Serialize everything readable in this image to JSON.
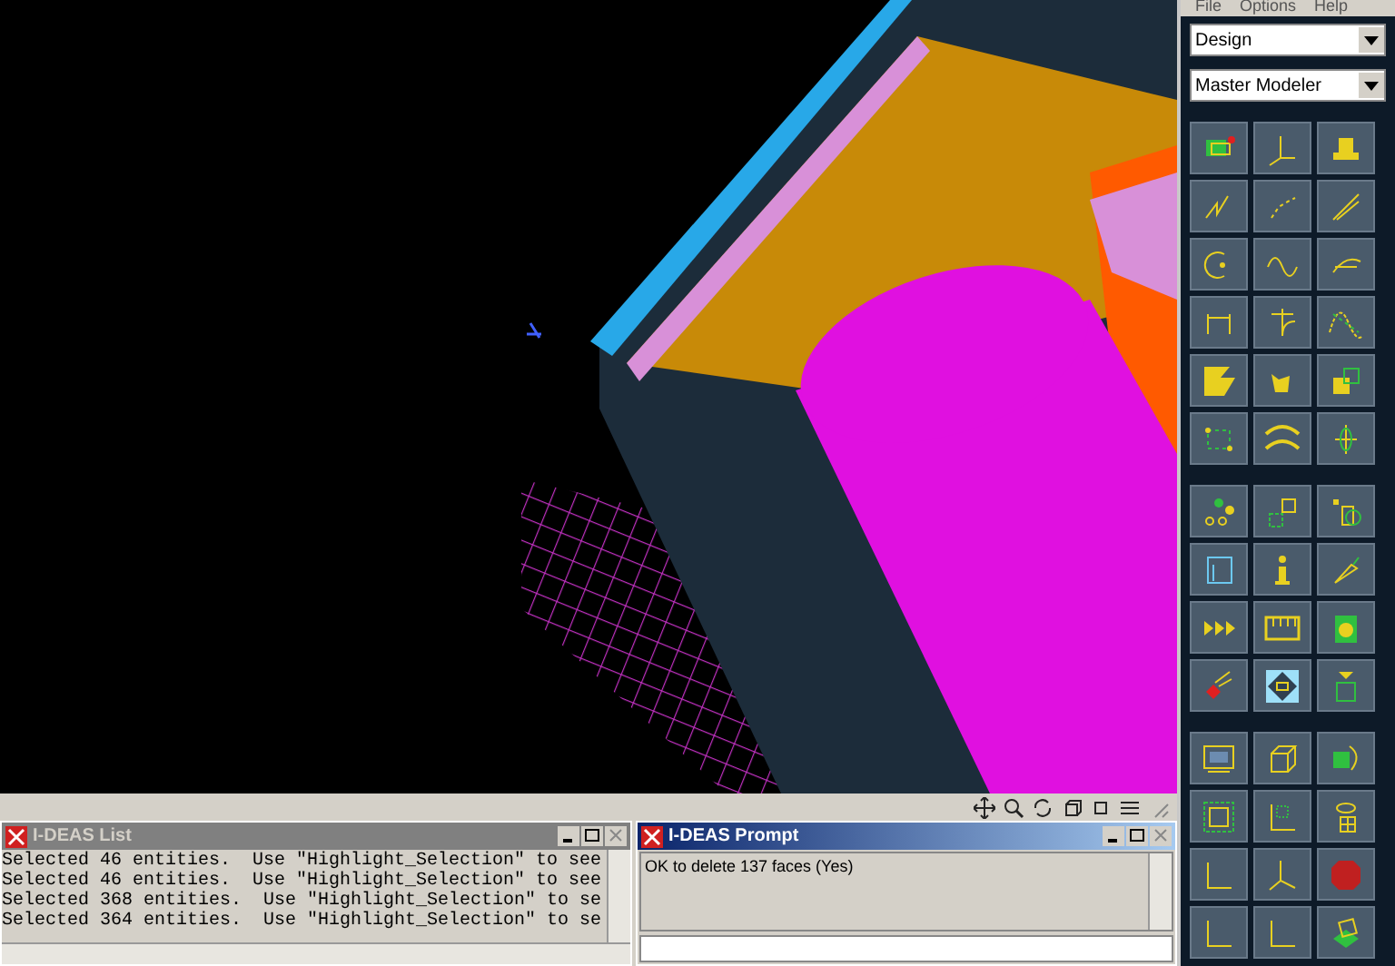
{
  "menu": [
    "File",
    "Options",
    "Help"
  ],
  "dropdowns": [
    {
      "value": "Design"
    },
    {
      "value": "Master Modeler"
    }
  ],
  "list_window": {
    "title": "I-DEAS List",
    "active": false,
    "lines": [
      "Selected 46 entities.  Use \"Highlight_Selection\" to see",
      "Selected 46 entities.  Use \"Highlight_Selection\" to see",
      "Selected 368 entities.  Use \"Highlight_Selection\" to se",
      "Selected 364 entities.  Use \"Highlight_Selection\" to se"
    ]
  },
  "prompt_window": {
    "title": "I-DEAS Prompt",
    "active": true,
    "message": "OK to delete 137 faces (Yes)"
  }
}
